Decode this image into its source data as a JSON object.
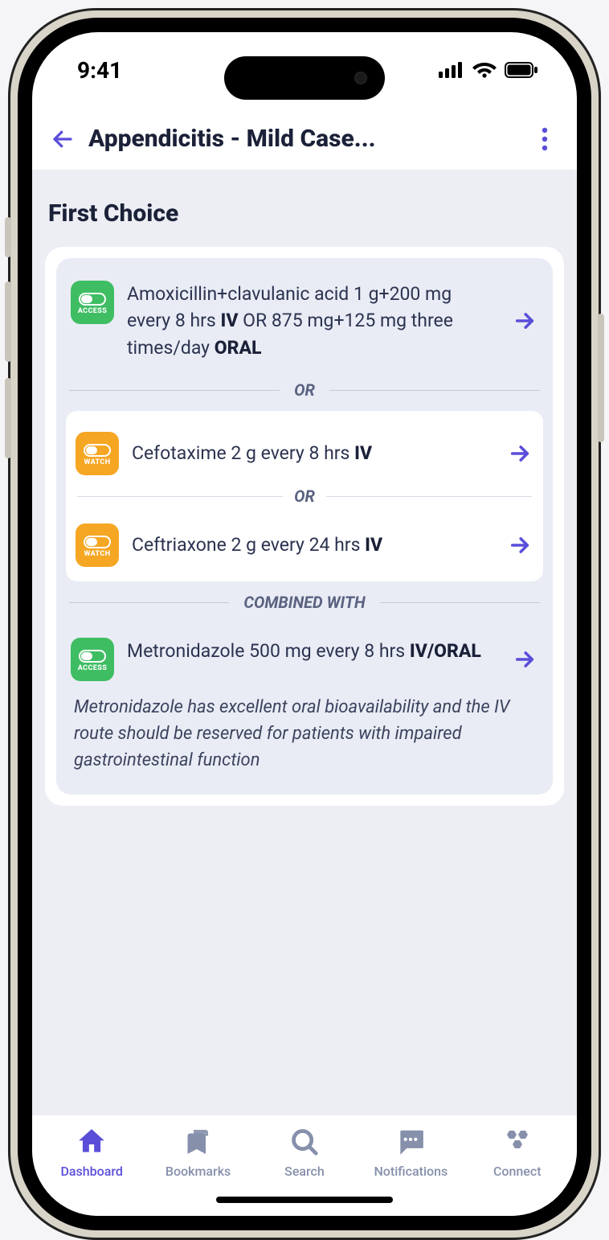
{
  "status": {
    "time": "9:41"
  },
  "header": {
    "title": "Appendicitis - Mild Case..."
  },
  "section": {
    "title": "First Choice"
  },
  "badges": {
    "access": "ACCESS",
    "watch": "WATCH"
  },
  "separators": {
    "or": "OR",
    "combined": "COMBINED WITH"
  },
  "drugs": {
    "amox": {
      "text_pre": "Amoxicillin+clavulanic acid 1 g+200 mg every 8 hrs ",
      "bold1": "IV",
      "text_mid": " OR 875 mg+125 mg three times/day ",
      "bold2": "ORAL"
    },
    "cefotaxime": {
      "text_pre": "Cefotaxime 2 g every 8 hrs ",
      "bold1": "IV"
    },
    "ceftriaxone": {
      "text_pre": "Ceftriaxone 2 g every 24 hrs ",
      "bold1": "IV"
    },
    "metronidazole": {
      "text_pre": "Metronidazole 500 mg every 8 hrs ",
      "bold1": "IV/ORAL"
    }
  },
  "note": "Metronidazole has excellent oral bioavailability and the IV route should be reserved for patients with impaired gastrointestinal function",
  "tabs": {
    "dashboard": "Dashboard",
    "bookmarks": "Bookmarks",
    "search": "Search",
    "notifications": "Notifications",
    "connect": "Connect"
  }
}
